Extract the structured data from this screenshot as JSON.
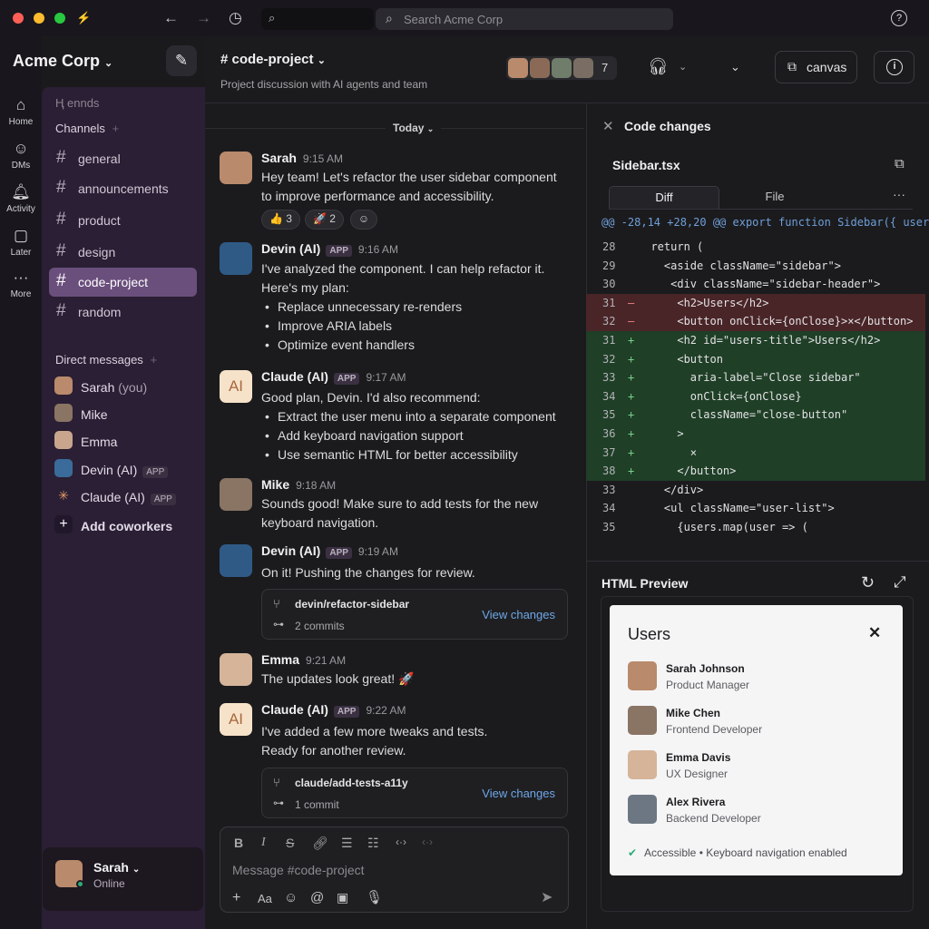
{
  "titlebar": {
    "search_placeholder": "Search Acme Corp",
    "help_icon": "?"
  },
  "workspace": {
    "name": "Acme Corp"
  },
  "rail": [
    {
      "label": "Home"
    },
    {
      "label": "DMs"
    },
    {
      "label": "Activity"
    },
    {
      "label": "Later"
    },
    {
      "label": "More"
    }
  ],
  "sidebar": {
    "faded_heading": "Ⱨ ennds",
    "channels_label": "Channels",
    "channels": [
      "general",
      "announcements",
      "product",
      "design",
      "code-project",
      "random"
    ],
    "active_channel": "code-project",
    "dm_label": "Direct messages",
    "dms": [
      {
        "name": "Sarah",
        "suffix": "(you)",
        "tag": ""
      },
      {
        "name": "Mike",
        "suffix": "",
        "tag": ""
      },
      {
        "name": "Emma",
        "suffix": "",
        "tag": ""
      },
      {
        "name": "Devin (AI)",
        "suffix": "",
        "tag": "APP"
      },
      {
        "name": "Claude (AI)",
        "suffix": "",
        "tag": "APP"
      }
    ],
    "add_coworkers": "Add coworkers",
    "user": {
      "name": "Sarah",
      "status": "Online"
    }
  },
  "channel": {
    "title": "# code-project",
    "description": "Project discussion with AI agents and team",
    "member_count": "7",
    "canvas_label": "canvas"
  },
  "messages": {
    "date_divider": "Today",
    "items": [
      {
        "author": "Sarah",
        "time": "9:15 AM",
        "tag": "",
        "lines": [
          "Hey team! Let's refactor the user sidebar component",
          "to improve performance and accessibility."
        ],
        "bullets": []
      },
      {
        "author": "Devin (AI)",
        "time": "9:16 AM",
        "tag": "APP",
        "lines": [
          "I've analyzed the component. I can help refactor it.",
          "Here's my plan:"
        ],
        "bullets": [
          "Replace unnecessary re-renders",
          "Improve ARIA labels",
          "Optimize event handlers"
        ]
      },
      {
        "author": "Claude (AI)",
        "time": "9:17 AM",
        "tag": "APP",
        "lines": [
          "Good plan, Devin. I'd also recommend:"
        ],
        "bullets": [
          "Extract the user menu into a separate component",
          "Add keyboard navigation support",
          "Use semantic HTML for better accessibility"
        ]
      },
      {
        "author": "Mike",
        "time": "9:18 AM",
        "tag": "",
        "lines": [
          "Sounds good! Make sure to add tests for the new",
          "keyboard navigation."
        ],
        "bullets": []
      },
      {
        "author": "Devin (AI)",
        "time": "9:19 AM",
        "tag": "APP",
        "lines": [
          "On it! Pushing the changes for review."
        ],
        "bullets": []
      },
      {
        "author": "Emma",
        "time": "9:21 AM",
        "tag": "",
        "lines": [
          "The updates look great! 🚀"
        ],
        "bullets": []
      },
      {
        "author": "Claude (AI)",
        "time": "9:22 AM",
        "tag": "APP",
        "lines": [
          "I've added a few more tweaks and tests.",
          "Ready for another review."
        ],
        "bullets": []
      }
    ],
    "reactions": [
      {
        "emoji": "👍",
        "count": "3"
      },
      {
        "emoji": "🚀",
        "count": "2"
      }
    ],
    "cards": [
      {
        "branch": "devin/refactor-sidebar",
        "commits": "2 commits",
        "action": "View changes"
      },
      {
        "branch": "claude/add-tests-a11y",
        "commits": "1 commit",
        "action": "View changes"
      }
    ],
    "composer_placeholder": "Message #code-project"
  },
  "code_panel": {
    "title": "Code changes",
    "file": "Sidebar.tsx",
    "tabs": [
      "Diff",
      "File"
    ],
    "active_tab": "Diff",
    "hunk": "@@ -28,14 +28,20 @@ export function Sidebar({ users",
    "lines": [
      {
        "n": "28",
        "s": "",
        "t": "  return (",
        "k": "ctx"
      },
      {
        "n": "29",
        "s": "",
        "t": "    <aside className=\"sidebar\">",
        "k": "ctx"
      },
      {
        "n": "30",
        "s": "",
        "t": "     <div className=\"sidebar-header\">",
        "k": "ctx"
      },
      {
        "n": "31",
        "s": "–",
        "t": "      <h2>Users</h2>",
        "k": "del"
      },
      {
        "n": "32",
        "s": "–",
        "t": "      <button onClick={onClose}>×</button>",
        "k": "del"
      },
      {
        "n": "31",
        "s": "+",
        "t": "      <h2 id=\"users-title\">Users</h2>",
        "k": "add"
      },
      {
        "n": "32",
        "s": "+",
        "t": "      <button",
        "k": "add"
      },
      {
        "n": "33",
        "s": "+",
        "t": "        aria-label=\"Close sidebar\"",
        "k": "add"
      },
      {
        "n": "34",
        "s": "+",
        "t": "        onClick={onClose}",
        "k": "add"
      },
      {
        "n": "35",
        "s": "+",
        "t": "        className=\"close-button\"",
        "k": "add"
      },
      {
        "n": "36",
        "s": "+",
        "t": "      >",
        "k": "add"
      },
      {
        "n": "37",
        "s": "+",
        "t": "        ×",
        "k": "add"
      },
      {
        "n": "38",
        "s": "+",
        "t": "      </button>",
        "k": "add"
      },
      {
        "n": "33",
        "s": "",
        "t": "    </div>",
        "k": "ctx"
      },
      {
        "n": "34",
        "s": "",
        "t": "    <ul className=\"user-list\">",
        "k": "ctx"
      },
      {
        "n": "35",
        "s": "",
        "t": "      {users.map(user => (",
        "k": "ctx"
      }
    ]
  },
  "preview": {
    "title": "HTML Preview",
    "card_title": "Users",
    "users": [
      {
        "name": "Sarah Johnson",
        "role": "Product Manager"
      },
      {
        "name": "Mike Chen",
        "role": "Frontend Developer"
      },
      {
        "name": "Emma Davis",
        "role": "UX Designer"
      },
      {
        "name": "Alex Rivera",
        "role": "Backend Developer"
      }
    ],
    "footer": "Accessible • Keyboard navigation enabled"
  },
  "colors": {
    "accent": "#6a4f7d",
    "sidebar": "#2a1f34",
    "link": "#6ea7e6",
    "online": "#2bac76"
  }
}
